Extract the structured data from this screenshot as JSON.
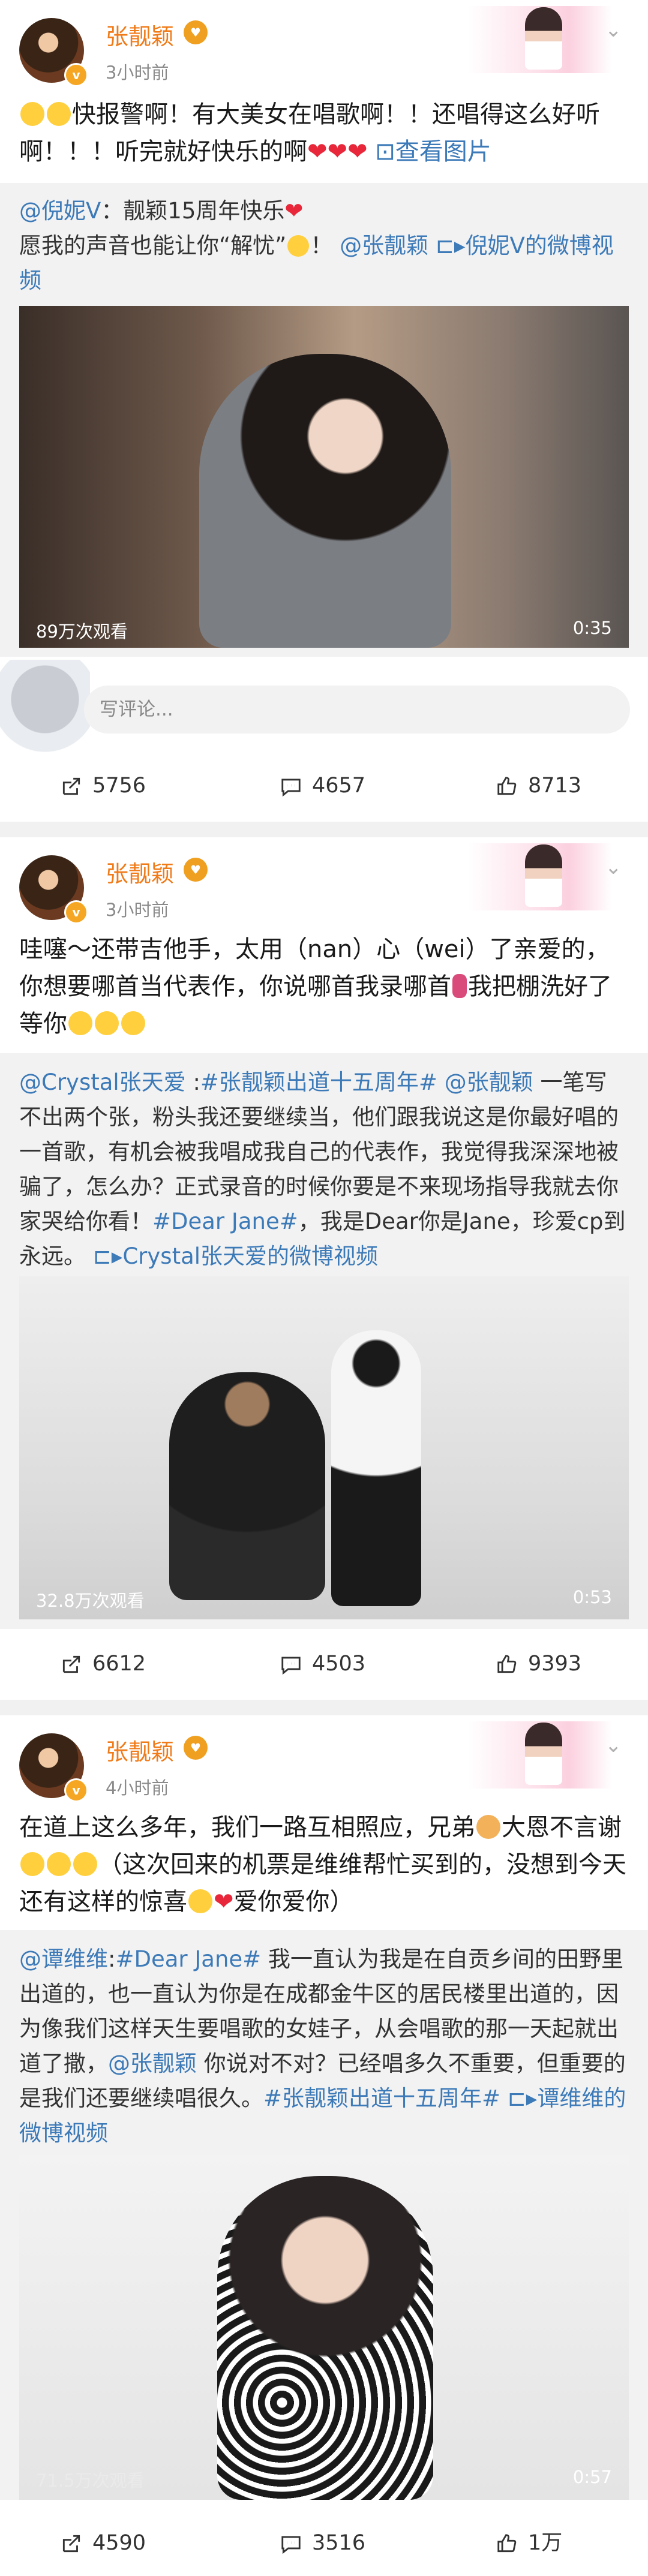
{
  "posts": [
    {
      "username": "张靓颖",
      "time": "3小时前",
      "text_parts": [
        "快报警啊！有大美女在唱歌啊！！还唱得这么好听啊！！！听完就好快乐的啊",
        "查看图片"
      ],
      "repost": {
        "author": "@倪妮V",
        "line1": "：靓颖15周年快乐",
        "line2a": "愿我的声音也能让你“解忧”",
        "mention": "@张靓颖",
        "video_link": "倪妮V的微博视频"
      },
      "video": {
        "views": "89万次观看",
        "duration": "0:35"
      },
      "comment_placeholder": "写评论...",
      "stats": {
        "reposts": "5756",
        "comments": "4657",
        "likes": "8713"
      }
    },
    {
      "username": "张靓颖",
      "time": "3小时前",
      "text": "哇噻～还带吉他手，太用（nan）心（wei）了亲爱的，你想要哪首当代表作，你说哪首我录哪首",
      "text_tail": "我把棚洗好了等你",
      "repost": {
        "author": "@Crystal张天爱",
        "tag1": "#张靓颖出道十五周年#",
        "mention": "@张靓颖",
        "body1": "一笔写不出两个张，粉头我还要继续当，他们跟我说这是你最好唱的一首歌，有机会被我唱成我自己的代表作，我觉得我深深地被骗了，怎么办？正式录音的时候你要是不来现场指导我就去你家哭给你看！",
        "tag2": "#Dear Jane#",
        "body2": "，我是Dear你是Jane，珍爱cp到永远。",
        "video_link": "Crystal张天爱的微博视频"
      },
      "video": {
        "views": "32.8万次观看",
        "duration": "0:53"
      },
      "stats": {
        "reposts": "6612",
        "comments": "4503",
        "likes": "9393"
      }
    },
    {
      "username": "张靓颖",
      "time": "4小时前",
      "text1": "在道上这么多年，我们一路互相照应，兄弟",
      "text2": "大恩不言谢",
      "text3": "（这次回来的机票是维维帮忙买到的，没想到今天还有这样的惊喜",
      "text4": "爱你爱你）",
      "repost": {
        "author": "@谭维维",
        "tag1": "#Dear Jane#",
        "body1": "我一直认为我是在自贡乡间的田野里出道的，也一直认为你是在成都金牛区的居民楼里出道的，因为像我们这样天生要唱歌的女娃子，从会唱歌的那一天起就出道了撒，",
        "mention": "@张靓颖",
        "body2": "你说对不对？已经唱多久不重要，但重要的是我们还要继续唱很久。",
        "tag2": "#张靓颖出道十五周年#",
        "video_link": "谭维维的微博视频"
      },
      "video": {
        "views": "71.5万次观看",
        "duration": "0:57"
      },
      "stats": {
        "reposts": "4590",
        "comments": "3516",
        "likes": "1万"
      }
    }
  ],
  "colors": {
    "link": "#3d7ab8",
    "username": "#f07b19",
    "heart": "#e8283a"
  }
}
